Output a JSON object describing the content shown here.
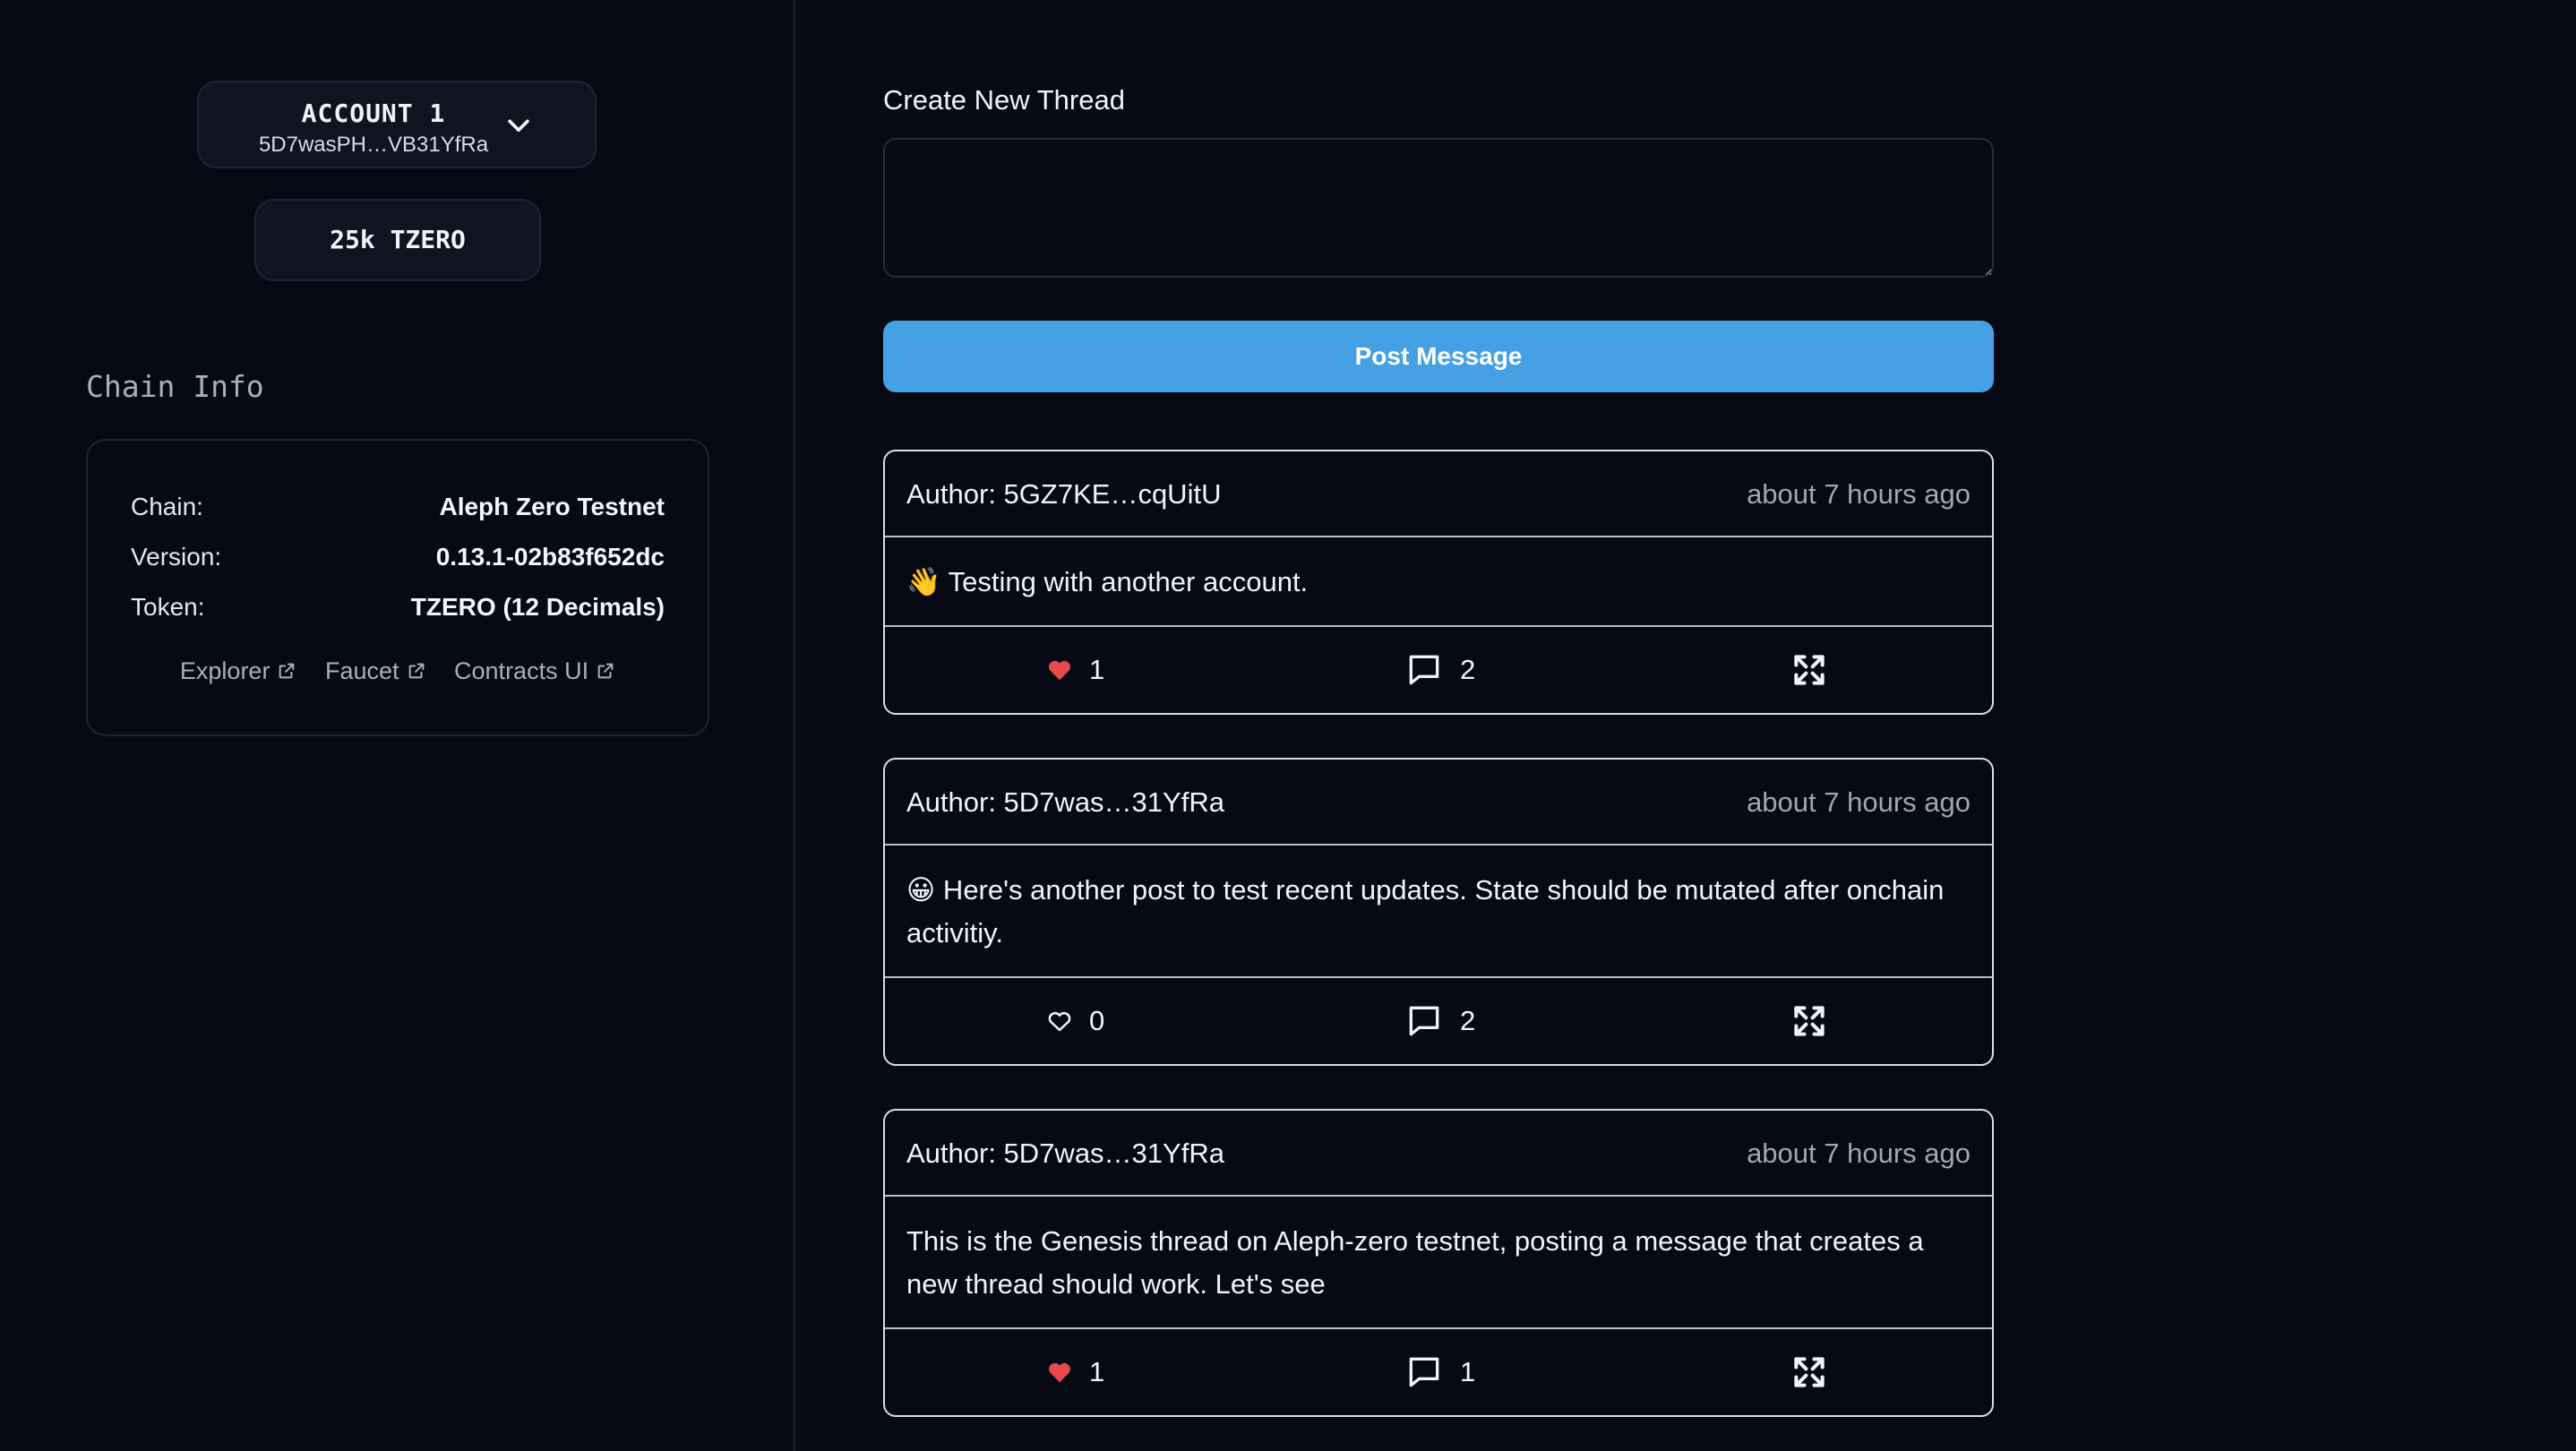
{
  "account": {
    "name": "ACCOUNT 1",
    "address": "5D7wasPH…VB31YfRa",
    "chevron_icon": "chevron-down-icon"
  },
  "balance": {
    "label": "25k TZERO"
  },
  "chain_info": {
    "heading": "Chain Info",
    "rows": [
      {
        "key": "Chain:",
        "value": "Aleph Zero Testnet"
      },
      {
        "key": "Version:",
        "value": "0.13.1-02b83f652dc"
      },
      {
        "key": "Token:",
        "value": "TZERO (12 Decimals)"
      }
    ],
    "links": [
      {
        "label": "Explorer",
        "icon": "external-link-icon"
      },
      {
        "label": "Faucet",
        "icon": "external-link-icon"
      },
      {
        "label": "Contracts UI",
        "icon": "external-link-icon"
      }
    ]
  },
  "composer": {
    "label": "Create New Thread",
    "input_value": "",
    "button_label": "Post Message",
    "button_color": "#45a1e3"
  },
  "posts": [
    {
      "author": "Author: 5GZ7KE…cqUitU",
      "time": "about 7 hours ago",
      "body": "👋 Testing with another account.",
      "likes": "1",
      "liked": true,
      "comments": "2"
    },
    {
      "author": "Author: 5D7was…31YfRa",
      "time": "about 7 hours ago",
      "body": "😀 Here's another post to test recent updates. State should be mutated after onchain activitiy.",
      "likes": "0",
      "liked": false,
      "comments": "2"
    },
    {
      "author": "Author: 5D7was…31YfRa",
      "time": "about 7 hours ago",
      "body": "This is the Genesis thread on Aleph-zero testnet, posting a message that creates a new thread should work. Let's see",
      "likes": "1",
      "liked": true,
      "comments": "1"
    }
  ],
  "colors": {
    "background": "#070a14",
    "heart_filled": "#e5484d",
    "accent": "#45a1e3"
  }
}
